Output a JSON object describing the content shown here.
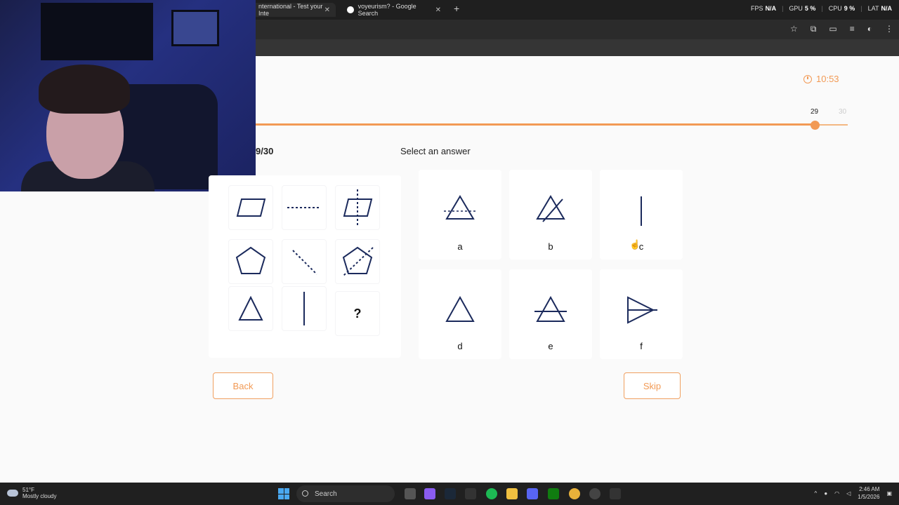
{
  "browser": {
    "tabs": [
      {
        "title": "nternational - Test your Inte",
        "active": true
      },
      {
        "title": "voyeurism? - Google Search",
        "active": false
      }
    ],
    "new_tab": "+",
    "stats": [
      {
        "label": "FPS",
        "value": "N/A"
      },
      {
        "label": "GPU",
        "value": "5 %"
      },
      {
        "label": "CPU",
        "value": "9 %"
      },
      {
        "label": "LAT",
        "value": "N/A"
      }
    ]
  },
  "test": {
    "timer": "10:53",
    "progress": {
      "current": "29",
      "max": "30",
      "fraction": 0.942
    },
    "counter": "9/30",
    "select_label": "Select an answer",
    "question_mark": "?",
    "answers": [
      "a",
      "b",
      "c",
      "d",
      "e",
      "f"
    ],
    "back_label": "Back",
    "skip_label": "Skip"
  },
  "taskbar": {
    "temperature": "51°F",
    "weather": "Mostly cloudy",
    "search_placeholder": "Search",
    "time": "2:46 AM",
    "date": "1/5/2026"
  },
  "colors": {
    "accent": "#f29a55",
    "shape_stroke": "#1b2a5c"
  }
}
